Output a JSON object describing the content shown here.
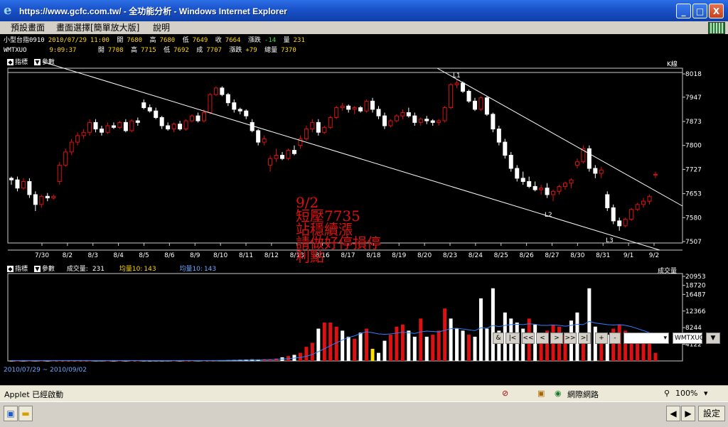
{
  "window": {
    "title": "https://www.gcfc.com.tw/ - 全功能分析 - Windows Internet Explorer",
    "minimize": "_",
    "maximize": "□",
    "close": "X"
  },
  "menu": [
    "預設畫面",
    "畫面選擇[簡單放大版]",
    "說明"
  ],
  "info": {
    "row1": {
      "name": "小型台指0910",
      "date": "2010/07/29",
      "time": "11:00",
      "open_l": "開",
      "open": "7680",
      "high_l": "高",
      "high": "7680",
      "low_l": "低",
      "low": "7649",
      "close_l": "收",
      "close": "7664",
      "chg_l": "漲跌",
      "chg": "-14",
      "vol_l": "量",
      "vol": "231"
    },
    "row2": {
      "name": "WMTXUO",
      "time": "9:09:37",
      "open_l": "開",
      "open": "7708",
      "high_l": "高",
      "high": "7715",
      "low_l": "低",
      "low": "7692",
      "close_l": "成",
      "close": "7707",
      "chg_l": "漲跌",
      "chg": "+79",
      "vol_l": "總量",
      "vol": "7370"
    }
  },
  "price_panel": {
    "indicator_label": "指標",
    "param_label": "參數",
    "period_label": "K線",
    "labels": {
      "l1": "L1",
      "l2": "L2",
      "l3": "L3"
    }
  },
  "volume_panel": {
    "indicator_label": "指標",
    "param_label": "參數",
    "vol_label": "成交量:",
    "vol_value": "231",
    "ma10_label": "均量10:",
    "ma10_value": "143",
    "ma10b_label": "均量10:",
    "ma10b_value": "143",
    "right_label": "成交量"
  },
  "annotation": [
    "9/2",
    "短壓7735",
    "站穩續漲",
    "請做好停損停",
    "利點"
  ],
  "range_text": "2010/07/29 ~ 2010/09/02",
  "nav": {
    "buttons": [
      "&",
      "|<",
      "<<",
      "<",
      ">",
      ">>",
      ">|",
      "+",
      "-"
    ],
    "symbol": "WMTXUO"
  },
  "status": {
    "applet": "Applet 已經啟動",
    "zone": "網際網路",
    "zoom": "100%"
  },
  "taskbar": {
    "settings": "設定"
  },
  "colors": {
    "up": "#dd1111",
    "down": "#ffffff",
    "ma_line": "#2f7fff",
    "highlight_bar": "#ffe000"
  },
  "chart_data": {
    "type": "bar",
    "title": "",
    "price_axis_ticks": [
      7507,
      7580,
      7653,
      7727,
      7800,
      7873,
      7947,
      8018
    ],
    "volume_axis_ticks": [
      4122,
      8244,
      12366,
      16487,
      18720,
      20953
    ],
    "x_tick_labels": [
      "7/30",
      "8/2",
      "8/3",
      "8/4",
      "8/5",
      "8/6",
      "8/9",
      "8/10",
      "8/11",
      "8/12",
      "8/13",
      "8/16",
      "8/17",
      "8/18",
      "8/19",
      "8/20",
      "8/23",
      "8/24",
      "8/25",
      "8/26",
      "8/27",
      "8/30",
      "8/31",
      "9/1",
      "9/2"
    ],
    "ylim_price": [
      7507,
      8018
    ],
    "ylim_volume": [
      0,
      20953
    ],
    "candles": [
      [
        7700,
        7705,
        7680,
        7695
      ],
      [
        7695,
        7705,
        7660,
        7670
      ],
      [
        7670,
        7700,
        7665,
        7690
      ],
      [
        7690,
        7700,
        7640,
        7650
      ],
      [
        7650,
        7660,
        7600,
        7620
      ],
      [
        7620,
        7650,
        7610,
        7645
      ],
      [
        7645,
        7655,
        7630,
        7640
      ],
      [
        7640,
        7650,
        7635,
        7645
      ],
      [
        7690,
        7750,
        7680,
        7740
      ],
      [
        7740,
        7790,
        7735,
        7780
      ],
      [
        7780,
        7820,
        7770,
        7810
      ],
      [
        7810,
        7840,
        7800,
        7830
      ],
      [
        7830,
        7850,
        7820,
        7840
      ],
      [
        7840,
        7880,
        7830,
        7870
      ],
      [
        7870,
        7880,
        7840,
        7850
      ],
      [
        7850,
        7860,
        7830,
        7840
      ],
      [
        7840,
        7870,
        7835,
        7860
      ],
      [
        7860,
        7870,
        7850,
        7855
      ],
      [
        7855,
        7875,
        7850,
        7870
      ],
      [
        7870,
        7880,
        7840,
        7845
      ],
      [
        7845,
        7880,
        7840,
        7875
      ],
      [
        7875,
        7885,
        7860,
        7870
      ],
      [
        7930,
        7940,
        7910,
        7915
      ],
      [
        7915,
        7925,
        7900,
        7905
      ],
      [
        7905,
        7915,
        7880,
        7885
      ],
      [
        7885,
        7890,
        7850,
        7860
      ],
      [
        7860,
        7870,
        7845,
        7850
      ],
      [
        7850,
        7870,
        7840,
        7865
      ],
      [
        7865,
        7875,
        7845,
        7850
      ],
      [
        7850,
        7880,
        7845,
        7875
      ],
      [
        7875,
        7895,
        7870,
        7890
      ],
      [
        7890,
        7900,
        7870,
        7875
      ],
      [
        7875,
        7910,
        7870,
        7900
      ],
      [
        7900,
        7960,
        7895,
        7955
      ],
      [
        7955,
        7980,
        7950,
        7975
      ],
      [
        7975,
        7980,
        7950,
        7955
      ],
      [
        7955,
        7960,
        7920,
        7930
      ],
      [
        7930,
        7940,
        7900,
        7910
      ],
      [
        7910,
        7915,
        7895,
        7905
      ],
      [
        7905,
        7910,
        7880,
        7890
      ],
      [
        7870,
        7880,
        7840,
        7845
      ],
      [
        7845,
        7850,
        7800,
        7810
      ],
      [
        7810,
        7830,
        7800,
        7820
      ],
      [
        7740,
        7770,
        7720,
        7760
      ],
      [
        7760,
        7790,
        7750,
        7770
      ],
      [
        7770,
        7780,
        7755,
        7760
      ],
      [
        7760,
        7790,
        7755,
        7785
      ],
      [
        7785,
        7800,
        7770,
        7775
      ],
      [
        7800,
        7830,
        7790,
        7820
      ],
      [
        7820,
        7860,
        7815,
        7850
      ],
      [
        7850,
        7880,
        7840,
        7870
      ],
      [
        7870,
        7880,
        7830,
        7840
      ],
      [
        7840,
        7860,
        7835,
        7855
      ],
      [
        7855,
        7890,
        7850,
        7885
      ],
      [
        7885,
        7920,
        7880,
        7915
      ],
      [
        7915,
        7930,
        7905,
        7920
      ],
      [
        7920,
        7925,
        7900,
        7910
      ],
      [
        7910,
        7920,
        7895,
        7915
      ],
      [
        7915,
        7920,
        7900,
        7905
      ],
      [
        7905,
        7940,
        7900,
        7935
      ],
      [
        7935,
        7945,
        7900,
        7910
      ],
      [
        7910,
        7920,
        7880,
        7890
      ],
      [
        7890,
        7900,
        7850,
        7860
      ],
      [
        7860,
        7880,
        7855,
        7875
      ],
      [
        7875,
        7895,
        7870,
        7890
      ],
      [
        7890,
        7910,
        7880,
        7900
      ],
      [
        7900,
        7915,
        7885,
        7890
      ],
      [
        7890,
        7900,
        7860,
        7870
      ],
      [
        7870,
        7885,
        7860,
        7880
      ],
      [
        7880,
        7890,
        7865,
        7875
      ],
      [
        7875,
        7880,
        7860,
        7870
      ],
      [
        7870,
        7880,
        7860,
        7875
      ],
      [
        7875,
        7920,
        7870,
        7915
      ],
      [
        7915,
        7990,
        7910,
        7985
      ],
      [
        7985,
        8000,
        7975,
        7990
      ],
      [
        7990,
        7995,
        7960,
        7965
      ],
      [
        7965,
        7970,
        7930,
        7935
      ],
      [
        7935,
        7945,
        7905,
        7910
      ],
      [
        7910,
        7950,
        7905,
        7945
      ],
      [
        7945,
        7950,
        7890,
        7895
      ],
      [
        7895,
        7900,
        7840,
        7850
      ],
      [
        7850,
        7860,
        7800,
        7810
      ],
      [
        7810,
        7820,
        7760,
        7770
      ],
      [
        7770,
        7780,
        7720,
        7730
      ],
      [
        7730,
        7740,
        7690,
        7700
      ],
      [
        7700,
        7720,
        7680,
        7690
      ],
      [
        7690,
        7705,
        7670,
        7675
      ],
      [
        7675,
        7690,
        7660,
        7665
      ],
      [
        7665,
        7680,
        7650,
        7670
      ],
      [
        7670,
        7685,
        7640,
        7650
      ],
      [
        7650,
        7665,
        7630,
        7660
      ],
      [
        7660,
        7680,
        7650,
        7675
      ],
      [
        7675,
        7690,
        7665,
        7685
      ],
      [
        7685,
        7700,
        7670,
        7695
      ],
      [
        7740,
        7760,
        7730,
        7750
      ],
      [
        7750,
        7800,
        7745,
        7790
      ],
      [
        7790,
        7800,
        7720,
        7730
      ],
      [
        7730,
        7740,
        7700,
        7715
      ],
      [
        7715,
        7735,
        7700,
        7725
      ],
      [
        7650,
        7660,
        7600,
        7610
      ],
      [
        7610,
        7620,
        7560,
        7570
      ],
      [
        7570,
        7580,
        7540,
        7555
      ],
      [
        7555,
        7580,
        7550,
        7575
      ],
      [
        7575,
        7610,
        7570,
        7605
      ],
      [
        7605,
        7625,
        7600,
        7620
      ],
      [
        7620,
        7640,
        7610,
        7630
      ],
      [
        7630,
        7650,
        7620,
        7645
      ],
      [
        7710,
        7720,
        7700,
        7712
      ]
    ],
    "volumes": [
      60,
      60,
      70,
      60,
      80,
      70,
      60,
      60,
      90,
      80,
      70,
      80,
      60,
      70,
      80,
      90,
      70,
      60,
      80,
      70,
      90,
      80,
      70,
      60,
      80,
      70,
      90,
      80,
      70,
      60,
      80,
      90,
      100,
      120,
      140,
      180,
      200,
      250,
      300,
      350,
      400,
      380,
      420,
      450,
      600,
      900,
      1200,
      1500,
      2000,
      3500,
      4500,
      8000,
      9500,
      9500,
      8500,
      7500,
      6000,
      5500,
      7000,
      8000,
      3000,
      2000,
      5000,
      6500,
      8500,
      9000,
      7500,
      6000,
      10500,
      6000,
      6500,
      7500,
      13000,
      10500,
      8000,
      7500,
      6500,
      6000,
      15500,
      8000,
      18000,
      7500,
      12000,
      10500,
      9500,
      8000,
      10500,
      9000,
      6000,
      7500,
      9000,
      8500,
      6500,
      10000,
      12000,
      6500,
      18000,
      8500,
      7000,
      6500,
      8000,
      9000,
      7500,
      6500,
      5000,
      5000,
      4500,
      2000
    ],
    "volume_up": [
      false,
      true,
      false,
      true,
      false,
      true,
      false,
      true,
      true,
      true,
      true,
      true,
      true,
      true,
      false,
      false,
      true,
      false,
      true,
      false,
      true,
      true,
      false,
      false,
      false,
      false,
      false,
      true,
      false,
      true,
      true,
      false,
      true,
      true,
      true,
      false,
      false,
      false,
      false,
      false,
      false,
      false,
      true,
      true,
      true,
      false,
      true,
      false,
      true,
      true,
      true,
      false,
      true,
      true,
      true,
      false,
      false,
      true,
      false,
      true,
      false,
      false,
      false,
      true,
      true,
      true,
      false,
      false,
      true,
      false,
      true,
      true,
      true,
      false,
      false,
      false,
      true,
      false,
      false,
      false,
      false,
      false,
      false,
      false,
      false,
      false,
      true,
      false,
      true,
      true,
      true,
      true,
      true,
      false,
      false,
      true,
      false,
      false,
      true,
      false,
      true,
      true,
      true,
      true,
      true,
      true,
      true,
      true
    ],
    "volume_ma10": [
      80,
      80,
      80,
      80,
      80,
      80,
      80,
      80,
      80,
      80,
      80,
      80,
      80,
      80,
      80,
      80,
      80,
      80,
      80,
      80,
      80,
      80,
      80,
      80,
      80,
      80,
      80,
      80,
      80,
      80,
      80,
      80,
      80,
      90,
      100,
      110,
      130,
      150,
      180,
      210,
      240,
      270,
      300,
      330,
      380,
      460,
      560,
      700,
      880,
      1150,
      1600,
      2300,
      3000,
      3800,
      4500,
      5200,
      5800,
      6200,
      6800,
      7200,
      7000,
      6700,
      6600,
      6700,
      6900,
      7100,
      7000,
      6800,
      7200,
      7400,
      7300,
      7200,
      7600,
      8000,
      8100,
      7900,
      7700,
      7500,
      8200,
      8100,
      8800,
      8500,
      8800,
      9000,
      9100,
      9000,
      9200,
      9100,
      8800,
      8800,
      8900,
      8800,
      8600,
      8800,
      9100,
      9000,
      9800,
      9400,
      9200,
      9000,
      8900,
      9000,
      8800,
      8500,
      8000,
      7500,
      7000,
      6500
    ]
  }
}
